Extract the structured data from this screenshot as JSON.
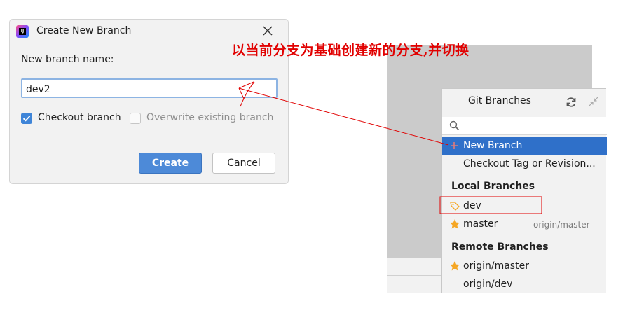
{
  "dialog": {
    "title": "Create New Branch",
    "field_label": "New branch name:",
    "branch_name": "dev2",
    "checkout_label": "Checkout branch",
    "checkout_checked": true,
    "overwrite_label": "Overwrite existing branch",
    "overwrite_checked": false,
    "create_label": "Create",
    "cancel_label": "Cancel"
  },
  "annotation": {
    "text": "以当前分支为基础创建新的分支,并切换",
    "color": "#e10000"
  },
  "popup": {
    "title": "Git Branches",
    "search_placeholder": "",
    "actions": [
      {
        "label": "New Branch",
        "selected": true,
        "icon": "plus-icon"
      },
      {
        "label": "Checkout Tag or Revision...",
        "selected": false
      }
    ],
    "local_heading": "Local Branches",
    "local_branches": [
      {
        "name": "dev",
        "icon": "tag-icon",
        "tracking": ""
      },
      {
        "name": "master",
        "icon": "star-icon",
        "tracking": "origin/master"
      }
    ],
    "remote_heading": "Remote Branches",
    "remote_branches": [
      {
        "name": "origin/master",
        "icon": "star-icon"
      },
      {
        "name": "origin/dev",
        "icon": ""
      }
    ]
  },
  "colors": {
    "accent": "#4d8ad8",
    "selection": "#2f70c9",
    "star": "#f5a623",
    "annotation": "#e10000"
  }
}
